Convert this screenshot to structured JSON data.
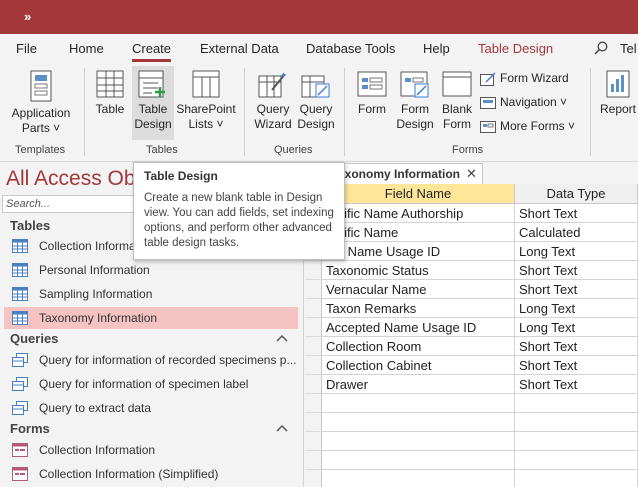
{
  "titlebar": {
    "qat_more": "»",
    "color": "#a4373a"
  },
  "tabs": [
    "File",
    "Home",
    "Create",
    "External Data",
    "Database Tools",
    "Help",
    "Table Design"
  ],
  "active_tab": "Create",
  "context_tab": "Table Design",
  "tell_me": "Tel",
  "ribbon": {
    "templates": {
      "application_parts_1": "Application",
      "application_parts_2": "Parts",
      "group": "Templates"
    },
    "tables": {
      "table": "Table",
      "table_design_1": "Table",
      "table_design_2": "Design",
      "sharepoint_1": "SharePoint",
      "sharepoint_2": "Lists",
      "group": "Tables"
    },
    "queries": {
      "wizard_1": "Query",
      "wizard_2": "Wizard",
      "design_1": "Query",
      "design_2": "Design",
      "group": "Queries"
    },
    "forms": {
      "form": "Form",
      "form_design_1": "Form",
      "form_design_2": "Design",
      "blank_form_1": "Blank",
      "blank_form_2": "Form",
      "form_wizard": "Form Wizard",
      "navigation": "Navigation",
      "more_forms": "More Forms",
      "group": "Forms"
    },
    "reports": {
      "report": "Report"
    }
  },
  "tooltip": {
    "title": "Table Design",
    "body": "Create a new blank table in Design view. You can add fields, set indexing options, and perform other advanced table design tasks."
  },
  "nav": {
    "title": "All Access Ob",
    "search_placeholder": "Search...",
    "sections": {
      "tables": "Tables",
      "queries": "Queries",
      "forms": "Forms"
    },
    "tables": [
      "Collection Informa",
      "Personal Information",
      "Sampling Information",
      "Taxonomy Information"
    ],
    "selected_table": "Taxonomy Information",
    "queries": [
      "Query for information of recorded specimens p...",
      "Query for information of specimen label",
      "Query to extract data"
    ],
    "forms": [
      "Collection Information",
      "Collection Information (Simplified)"
    ]
  },
  "document": {
    "tab_label": "axonomy Information",
    "headers": {
      "field_name": "Field Name",
      "data_type": "Data Type"
    },
    "rows": [
      {
        "field": "entific Name Authorship",
        "type": "Short Text"
      },
      {
        "field": "entific Name",
        "type": "Calculated"
      },
      {
        "field": "ent Name Usage ID",
        "type": "Long Text"
      },
      {
        "field": "Taxonomic Status",
        "type": "Short Text"
      },
      {
        "field": "Vernacular Name",
        "type": "Short Text"
      },
      {
        "field": "Taxon Remarks",
        "type": "Long Text"
      },
      {
        "field": "Accepted Name Usage ID",
        "type": "Long Text"
      },
      {
        "field": "Collection Room",
        "type": "Short Text"
      },
      {
        "field": "Collection Cabinet",
        "type": "Short Text"
      },
      {
        "field": "Drawer",
        "type": "Short Text"
      }
    ]
  },
  "colors": {
    "accent": "#a4373a",
    "header_highlight": "#ffe699",
    "selected_row": "#f6c3c3"
  }
}
